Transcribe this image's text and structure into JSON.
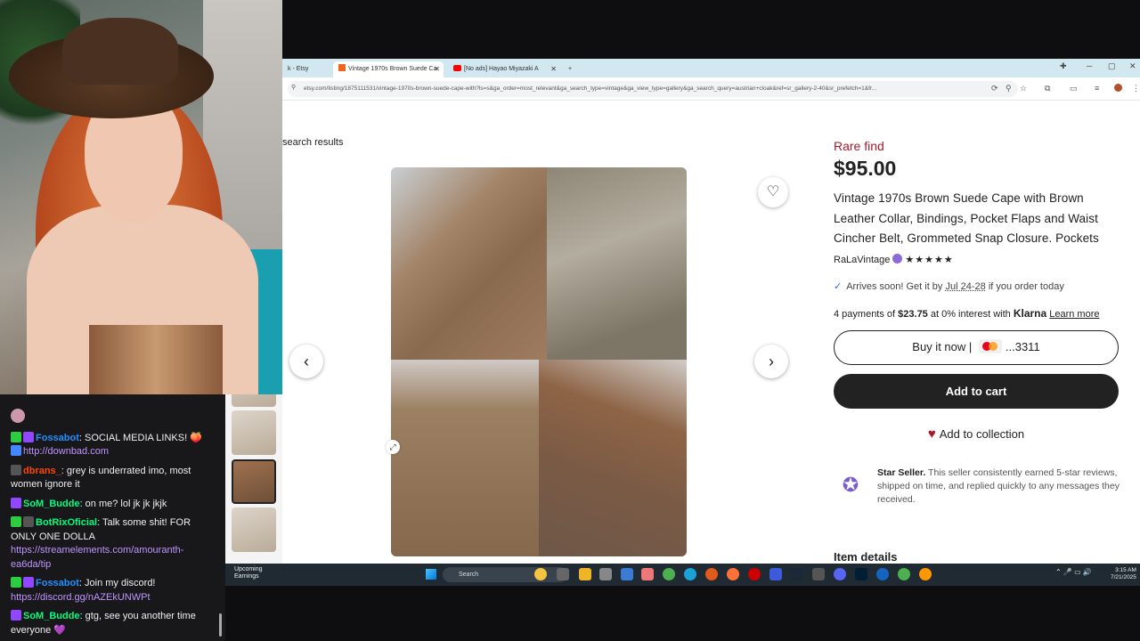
{
  "chat": {
    "messages": [
      {
        "user": "Fossabot",
        "text": ": SOCIAL MEDIA LINKS! 🍑",
        "user_color": "#1e90ff",
        "badges": [
          "green",
          "purple"
        ]
      },
      {
        "user": "",
        "text": "http://downbad.com",
        "link": true
      },
      {
        "user": "dbrans_",
        "text": ": grey is underrated imo, most women ignore it",
        "user_color": "#ff4500",
        "badges": [
          "gray"
        ]
      },
      {
        "user": "SoM_Budde",
        "text": ": on me? lol jk jk jkjk",
        "user_color": "#00ff7f",
        "badges": [
          "purple"
        ]
      },
      {
        "user": "BotRixOficial",
        "text": ": Talk some shit! FOR ONLY ONE DOLLA",
        "user_color": "#00ff7f",
        "badges": [
          "green",
          "gray"
        ]
      },
      {
        "user": "",
        "text": "https://streamelements.com/amouranth-ea6da/tip",
        "link": true
      },
      {
        "user": "Fossabot",
        "text": ": Join my discord!",
        "user_color": "#1e90ff",
        "badges": [
          "green",
          "purple"
        ]
      },
      {
        "user": "",
        "text": "https://discord.gg/nAZEkUNWPt",
        "link": true
      },
      {
        "user": "SoM_Budde",
        "text": ": gtg, see you another time everyone 💜",
        "user_color": "#00ff7f",
        "badges": [
          "purple"
        ]
      }
    ]
  },
  "browser": {
    "tabs": [
      {
        "label": "k - Etsy",
        "active": false
      },
      {
        "label": "Vintage 1970s Brown Suede Ca",
        "active": true
      },
      {
        "label": "[No ads] Hayao Miyazaki A",
        "active": false
      }
    ],
    "new_tab": "+",
    "url": "etsy.com/listing/1875111531/vintage-1970s-brown-suede-cape-with?ls=s&ga_order=most_relevant&ga_search_type=vintage&ga_view_type=gallery&ga_search_query=austrian+cloak&ref=sr_gallery-2-40&sr_prefetch=1&fr..."
  },
  "listing": {
    "back_link": "search results",
    "rare_find": "Rare find",
    "price": "$95.00",
    "title": "Vintage 1970s Brown Suede Cape with Brown Leather Collar, Bindings, Pocket Flaps and Waist Cincher Belt, Grommeted Snap Closure. Pockets",
    "seller": "RaLaVintage",
    "stars": "★★★★★",
    "arrives_prefix": "Arrives soon! Get it by",
    "arrives_dates": "Jul 24-28",
    "arrives_suffix": "if you order today",
    "klarna_prefix": "4 payments of",
    "klarna_amount": "$23.75",
    "klarna_mid": "at 0% interest with",
    "klarna_brand": "Klarna",
    "klarna_link": "Learn more",
    "buy_now_label": "Buy it now",
    "card_suffix": "...3311",
    "add_to_cart": "Add to cart",
    "add_to_collection": "Add to collection",
    "star_seller_title": "Star Seller.",
    "star_seller_text": "This seller consistently earned 5-star reviews, shipped on time, and replied quickly to any messages they received.",
    "item_details": "Item details"
  },
  "taskbar": {
    "weather_line1": "Upcoming",
    "weather_line2": "Earnings",
    "search": "Search",
    "time": "3:15 AM",
    "date": "7/21/2025"
  },
  "colors": {
    "etsy_red": "#a61a2e",
    "chat_bg": "#18181b",
    "taskbar_bg": "#1f2a33"
  }
}
